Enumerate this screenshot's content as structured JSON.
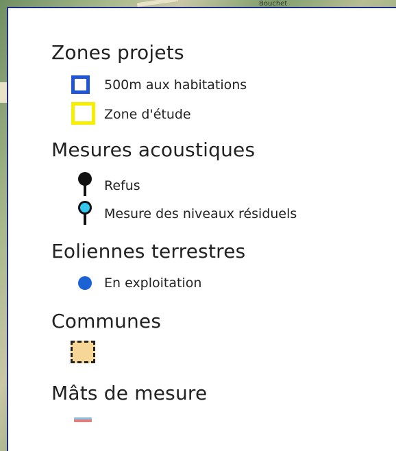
{
  "map": {
    "place_label": "Bouchet"
  },
  "legend": {
    "groups": [
      {
        "title": "Zones projets",
        "items": [
          {
            "label": "500m aux habitations",
            "symbol": "blue-square-outline",
            "color": "#1f56d6"
          },
          {
            "label": "Zone d'étude",
            "symbol": "yellow-square-outline",
            "color": "#f4f000"
          }
        ]
      },
      {
        "title": "Mesures acoustiques",
        "items": [
          {
            "label": "Refus",
            "symbol": "black-pin-icon",
            "color": "#111111"
          },
          {
            "label": "Mesure des niveaux résiduels",
            "symbol": "cyan-pin-icon",
            "color": "#35c8ee"
          }
        ]
      },
      {
        "title": "Eoliennes terrestres",
        "items": [
          {
            "label": "En exploitation",
            "symbol": "blue-dot",
            "color": "#1c62d4"
          }
        ]
      },
      {
        "title": "Communes",
        "items": [
          {
            "label": "",
            "symbol": "dashed-square-outline",
            "color": "#f7d797"
          }
        ]
      },
      {
        "title": "Mâts de mesure",
        "items": [
          {
            "label": "",
            "symbol": "mast-line",
            "color": "#8fbfe0"
          }
        ]
      }
    ]
  }
}
